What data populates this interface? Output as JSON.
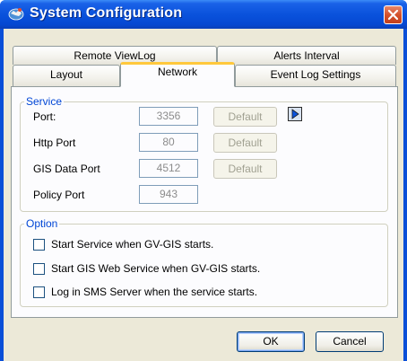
{
  "window": {
    "title": "System Configuration"
  },
  "tabs_row_back": [
    {
      "label": "Remote ViewLog"
    },
    {
      "label": "Alerts Interval"
    }
  ],
  "tabs_row_front": [
    {
      "label": "Layout"
    },
    {
      "label": "Network",
      "active": true
    },
    {
      "label": "Event Log Settings"
    }
  ],
  "service": {
    "legend": "Service",
    "rows": [
      {
        "label": "Port:",
        "value": "3356",
        "button": "Default"
      },
      {
        "label": "Http Port",
        "value": "80",
        "button": "Default"
      },
      {
        "label": "GIS Data Port",
        "value": "4512",
        "button": "Default"
      },
      {
        "label": "Policy Port",
        "value": "943"
      }
    ]
  },
  "option": {
    "legend": "Option",
    "checkboxes": [
      {
        "label": "Start Service when GV-GIS starts.",
        "checked": false
      },
      {
        "label": "Start GIS Web Service when GV-GIS starts.",
        "checked": false
      },
      {
        "label": "Log in SMS Server when the service starts.",
        "checked": false
      }
    ]
  },
  "footer": {
    "ok": "OK",
    "cancel": "Cancel"
  },
  "colors": {
    "titlebar": "#0a52dc",
    "legend": "#0046d5",
    "active_tab_accent": "#ffc83c",
    "close": "#d4512c"
  }
}
